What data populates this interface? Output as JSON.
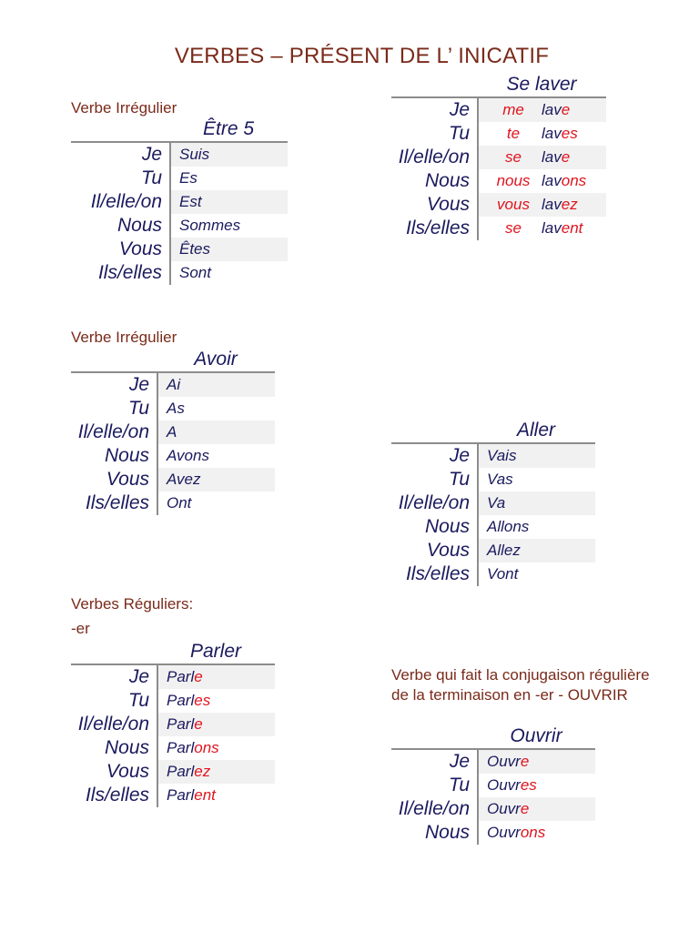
{
  "page_title": "VERBES – PRÉSENT DE L’ INICATIF",
  "colors": {
    "heading": "#7a2a1a",
    "text": "#1a1a5e",
    "ending": "#e0141e",
    "shade": "#f1f1f1"
  },
  "sections": {
    "etre": {
      "heading": "Verbe Irrégulier",
      "verb": "Être 5",
      "rows": [
        {
          "pronoun": "Je",
          "stem": "Suis",
          "ending": ""
        },
        {
          "pronoun": "Tu",
          "stem": "Es",
          "ending": ""
        },
        {
          "pronoun": "Il/elle/on",
          "stem": "Est",
          "ending": ""
        },
        {
          "pronoun": "Nous",
          "stem": "Sommes",
          "ending": ""
        },
        {
          "pronoun": "Vous",
          "stem": "Êtes",
          "ending": ""
        },
        {
          "pronoun": "Ils/elles",
          "stem": "Sont",
          "ending": ""
        }
      ]
    },
    "se_laver": {
      "verb": "Se laver",
      "rows": [
        {
          "pronoun": "Je",
          "reflexive": "me",
          "stem": "lav",
          "ending": "e"
        },
        {
          "pronoun": "Tu",
          "reflexive": "te",
          "stem": "lav",
          "ending": "es"
        },
        {
          "pronoun": "Il/elle/on",
          "reflexive": "se",
          "stem": "lav",
          "ending": "e"
        },
        {
          "pronoun": "Nous",
          "reflexive": "nous",
          "stem": "lav",
          "ending": "ons"
        },
        {
          "pronoun": "Vous",
          "reflexive": "vous",
          "stem": "lav",
          "ending": "ez"
        },
        {
          "pronoun": "Ils/elles",
          "reflexive": "se",
          "stem": "lav",
          "ending": "ent"
        }
      ]
    },
    "avoir": {
      "heading": "Verbe Irrégulier",
      "verb": "Avoir",
      "rows": [
        {
          "pronoun": "Je",
          "stem": "Ai",
          "ending": ""
        },
        {
          "pronoun": "Tu",
          "stem": "As",
          "ending": ""
        },
        {
          "pronoun": "Il/elle/on",
          "stem": "A",
          "ending": ""
        },
        {
          "pronoun": "Nous",
          "stem": "Avons",
          "ending": ""
        },
        {
          "pronoun": "Vous",
          "stem": "Avez",
          "ending": ""
        },
        {
          "pronoun": "Ils/elles",
          "stem": "Ont",
          "ending": ""
        }
      ]
    },
    "aller": {
      "verb": "Aller",
      "rows": [
        {
          "pronoun": "Je",
          "stem": "Vais",
          "ending": ""
        },
        {
          "pronoun": "Tu",
          "stem": "Vas",
          "ending": ""
        },
        {
          "pronoun": "Il/elle/on",
          "stem": "Va",
          "ending": ""
        },
        {
          "pronoun": "Nous",
          "stem": "Allons",
          "ending": ""
        },
        {
          "pronoun": "Vous",
          "stem": "Allez",
          "ending": ""
        },
        {
          "pronoun": "Ils/elles",
          "stem": "Vont",
          "ending": ""
        }
      ]
    },
    "parler": {
      "heading": "Verbes Réguliers:",
      "subheading": "-er",
      "verb": "Parler",
      "rows": [
        {
          "pronoun": "Je",
          "stem": "Parl",
          "ending": "e"
        },
        {
          "pronoun": "Tu",
          "stem": "Parl",
          "ending": "es"
        },
        {
          "pronoun": "Il/elle/on",
          "stem": "Parl",
          "ending": "e"
        },
        {
          "pronoun": "Nous",
          "stem": "Parl",
          "ending": "ons"
        },
        {
          "pronoun": "Vous",
          "stem": "Parl",
          "ending": "ez"
        },
        {
          "pronoun": "Ils/elles",
          "stem": "Parl",
          "ending": "ent"
        }
      ]
    },
    "ouvrir": {
      "heading": "Verbe qui fait la conjugaison régulière de la terminaison en -er - OUVRIR",
      "verb": "Ouvrir",
      "rows": [
        {
          "pronoun": "Je",
          "stem": "Ouvr",
          "ending": "e"
        },
        {
          "pronoun": "Tu",
          "stem": "Ouvr",
          "ending": "es"
        },
        {
          "pronoun": "Il/elle/on",
          "stem": "Ouvr",
          "ending": "e"
        },
        {
          "pronoun": "Nous",
          "stem": "Ouvr",
          "ending": "ons"
        }
      ]
    }
  }
}
